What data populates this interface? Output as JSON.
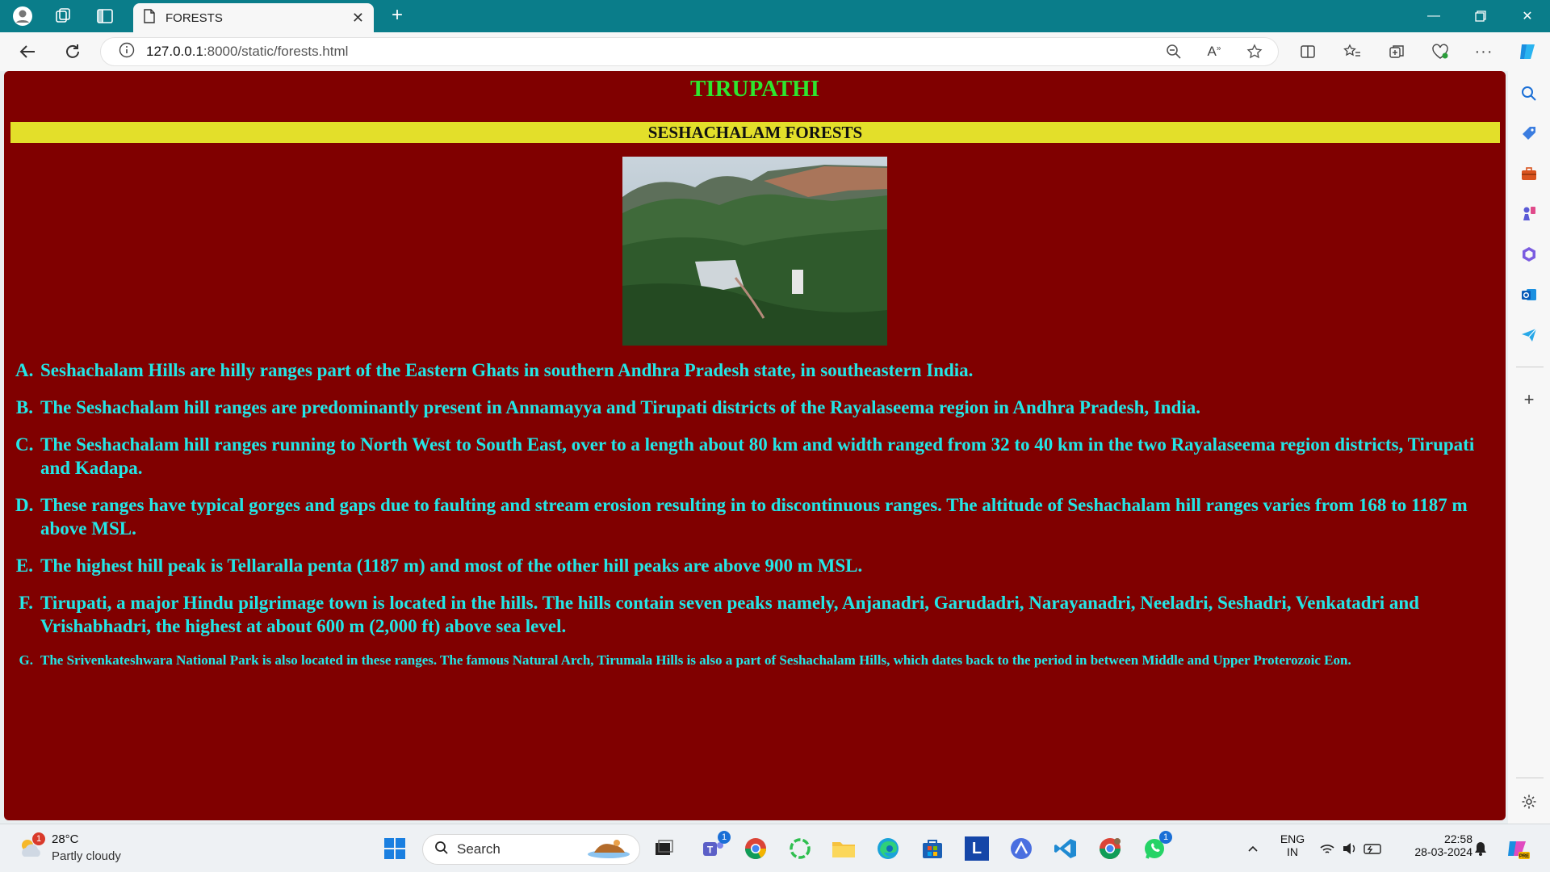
{
  "browser": {
    "tab_title": "FORESTS",
    "url_host": "127.0.0.1",
    "url_path": ":8000/static/forests.html"
  },
  "page": {
    "title": "TIRUPATHI",
    "subtitle": "SESHACHALAM FORESTS",
    "title_color": "#2ee62e",
    "background_color": "#800000",
    "banner_color": "#e3df2a",
    "text_color": "#23e6e6",
    "facts": [
      {
        "marker": "A.",
        "text": "Seshachalam Hills are hilly ranges part of the Eastern Ghats in southern Andhra Pradesh state, in southeastern India."
      },
      {
        "marker": "B.",
        "text": "The Seshachalam hill ranges are predominantly present in Annamayya and Tirupati districts of the Rayalaseema region in Andhra Pradesh, India."
      },
      {
        "marker": "C.",
        "text": "The Seshachalam hill ranges running to North West to South East, over to a length about 80 km and width ranged from 32 to 40 km in the two Rayalaseema region districts, Tirupati and Kadapa."
      },
      {
        "marker": "D.",
        "text": "These ranges have typical gorges and gaps due to faulting and stream erosion resulting in to discontinuous ranges. The altitude of Seshachalam hill ranges varies from 168 to 1187 m above MSL."
      },
      {
        "marker": "E.",
        "text": "The highest hill peak is Tellaralla penta (1187 m) and most of the other hill peaks are above 900 m MSL."
      },
      {
        "marker": "F.",
        "text": "Tirupati, a major Hindu pilgrimage town is located in the hills. The hills contain seven peaks namely, Anjanadri, Garudadri, Narayanadri, Neeladri, Seshadri, Venkatadri and Vrishabhadri, the highest at about 600 m (2,000 ft) above sea level."
      },
      {
        "marker": "G.",
        "text": "The Srivenkateshwara National Park is also located in these ranges. The famous Natural Arch, Tirumala Hills is also a part of Seshachalam Hills, which dates back to the period in between Middle and Upper Proterozoic Eon."
      }
    ]
  },
  "taskbar": {
    "weather_temp": "28°C",
    "weather_cond": "Partly cloudy",
    "weather_badge": "1",
    "search_placeholder": "Search",
    "teams_badge": "1",
    "whatsapp_badge": "1",
    "lang_top": "ENG",
    "lang_bottom": "IN",
    "time": "22:58",
    "date": "28-03-2024",
    "app_letter": "L"
  }
}
